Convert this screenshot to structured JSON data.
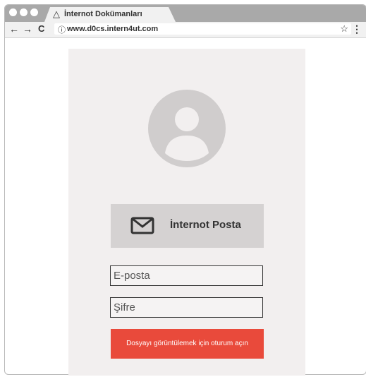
{
  "browser": {
    "tab_icon": "warning-triangle-icon",
    "tab_title": "İnternot Dokümanları",
    "back_glyph": "←",
    "forward_glyph": "→",
    "reload_glyph": "C",
    "info_glyph": "ⓘ",
    "url": "www.d0cs.intern4ut.com",
    "star_glyph": "☆",
    "menu_glyph": "⋮"
  },
  "login": {
    "avatar_icon": "user-avatar-icon",
    "mail_button_icon": "envelope-icon",
    "mail_button_label": "İnternot Posta",
    "email_placeholder": "E-posta",
    "password_placeholder": "Şifre",
    "submit_label": "Dosyayı görüntülemek için oturum açın"
  },
  "colors": {
    "chrome_dark": "#a9a9a9",
    "chrome_light": "#f1f1f1",
    "card_bg": "#f2efef",
    "avatar_gray": "#d0cdcd",
    "mail_button_bg": "#d5d2d2",
    "submit_bg": "#e94a3b"
  }
}
